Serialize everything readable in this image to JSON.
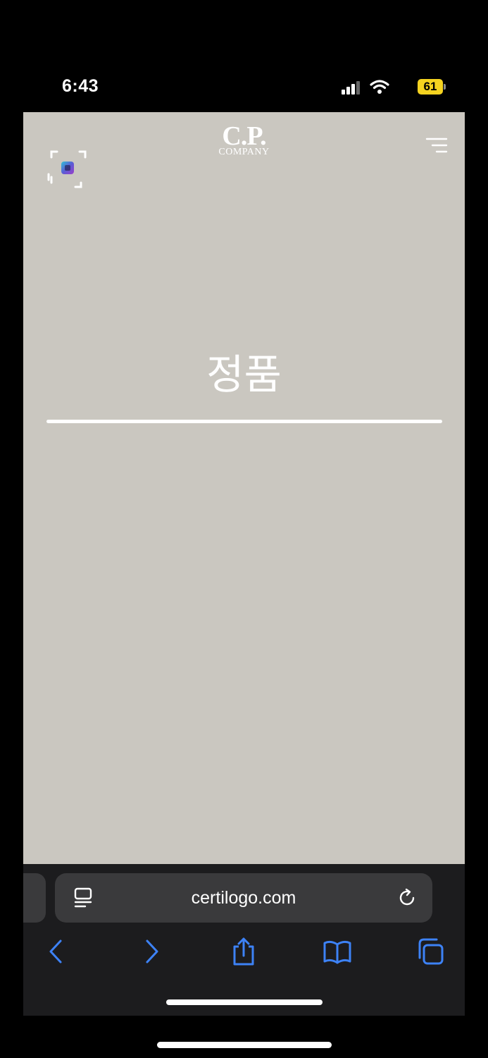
{
  "status_bar": {
    "time": "6:43",
    "battery_level": "61",
    "battery_color": "#f5d320",
    "signal_icon": "cellular-signal-icon",
    "wifi_icon": "wifi-icon"
  },
  "page": {
    "background": "#cac7c0",
    "logo": {
      "main": "C.P.",
      "sub": "COMPANY"
    },
    "headline": "정품",
    "icons": {
      "scan": "scan-icon",
      "menu": "hamburger-menu-icon"
    }
  },
  "browser": {
    "url": "certilogo.com",
    "icons": {
      "reader": "reader-view-icon",
      "reload": "reload-icon",
      "back": "back-chevron-icon",
      "forward": "forward-chevron-icon",
      "share": "share-icon",
      "bookmarks": "bookmarks-book-icon",
      "tabs": "tabs-icon"
    },
    "accent": "#3d82f6"
  }
}
